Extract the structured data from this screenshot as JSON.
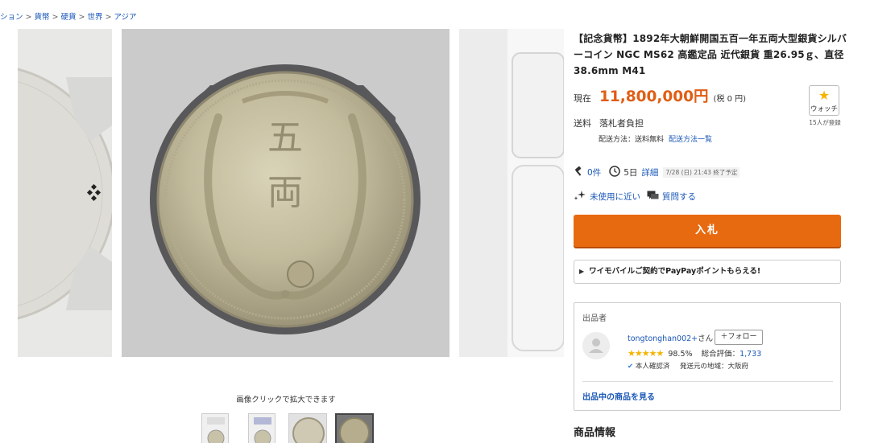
{
  "breadcrumb": {
    "items": [
      "ション",
      "貨幣",
      "硬貨",
      "世界",
      "アジア"
    ],
    "separator": ">"
  },
  "gallery": {
    "caption": "画像クリックで拡大できます",
    "thumbnail_count": 4
  },
  "item": {
    "title": "【記念貨幣】1892年大朝鮮開国五百一年五両大型銀貨シルバーコイン NGC MS62 高鑑定品 近代銀貨 重26.95ｇ、直径38.6mm M41",
    "price_label": "現在",
    "price": "11,800,000円",
    "tax": "(税 0 円)",
    "shipping_label": "送料",
    "shipping_value": "落札者負担",
    "ship_method_label": "配送方法：送料無料",
    "ship_method_link": "配送方法一覧",
    "bids": "0件",
    "remaining": "5日",
    "detail_link": "詳細",
    "end_time": "7/28 (日) 21:43 終了予定",
    "condition": "未使用に近い",
    "question_link": "質問する",
    "bid_button": "入札"
  },
  "watch": {
    "label": "ウォッチ",
    "count": "15人が登録"
  },
  "promo": {
    "text": "ワイモバイルご契約でPayPayポイントもらえる!"
  },
  "seller": {
    "heading": "出品者",
    "name": "tongtonghan002+",
    "honorific": "さん",
    "follow": "＋フォロー",
    "positive_rate": "98.5%",
    "total_label": "総合評価：",
    "total_count": "1,733",
    "verified": "本人確認済",
    "location": "発送元の地域：大阪府",
    "items_link": "出品中の商品を見る"
  },
  "section": {
    "product_info": "商品情報"
  },
  "colors": {
    "accent_price": "#e05e14",
    "bid_button": "#e86a10",
    "link": "#1a57b8",
    "star": "#f4b400"
  }
}
